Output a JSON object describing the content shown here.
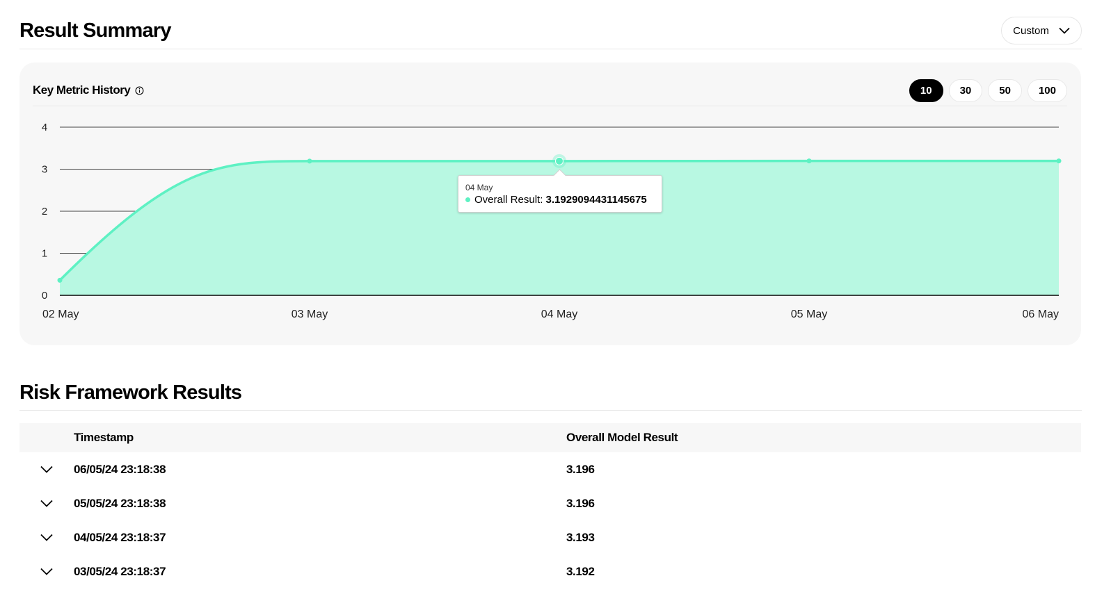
{
  "summary": {
    "title": "Result Summary",
    "period_select": {
      "label": "Custom",
      "icon": "chevron-down-icon"
    }
  },
  "metric_card": {
    "title": "Key Metric History",
    "info_icon": "info-icon",
    "ranges": [
      "10",
      "30",
      "50",
      "100"
    ],
    "active_range": "10"
  },
  "chart_data": {
    "type": "area",
    "x": [
      "02 May",
      "03 May",
      "04 May",
      "05 May",
      "06 May"
    ],
    "series": [
      {
        "name": "Overall Result",
        "values": [
          0.357,
          3.192,
          3.193,
          3.196,
          3.196
        ],
        "color": "#5ef1c3",
        "fill": "#b8f8e2"
      }
    ],
    "ylim": [
      0,
      4
    ],
    "yticks": [
      "0",
      "1",
      "2",
      "3",
      "4"
    ],
    "grid": true
  },
  "tooltip": {
    "date": "04 May",
    "series_label": "Overall Result:",
    "value": "3.1929094431145675"
  },
  "risk": {
    "title": "Risk Framework Results",
    "columns": {
      "timestamp": "Timestamp",
      "result": "Overall Model Result"
    },
    "rows": [
      {
        "timestamp": "06/05/24 23:18:38",
        "result": "3.196"
      },
      {
        "timestamp": "05/05/24 23:18:38",
        "result": "3.196"
      },
      {
        "timestamp": "04/05/24 23:18:37",
        "result": "3.193"
      },
      {
        "timestamp": "03/05/24 23:18:37",
        "result": "3.192"
      }
    ]
  },
  "colors": {
    "accent": "#5ef1c3",
    "accent_fill": "#b8f8e2",
    "card_bg": "#f7f7f7"
  }
}
